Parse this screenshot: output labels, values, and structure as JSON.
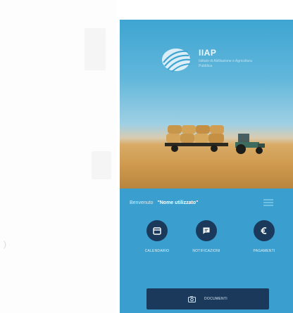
{
  "app": {
    "logo_title": "IIAP",
    "logo_subtitle": "Istituto di Abilitazione e Agricoltura Pubblica"
  },
  "main": {
    "welcome_label": "Benvenuto",
    "user_name": "\"Nome utilizzato\""
  },
  "quick_actions": [
    {
      "label": "CALENDARIO",
      "icon": "calendar-icon"
    },
    {
      "label": "NOTIFICAZIONI",
      "icon": "message-icon"
    },
    {
      "label": "PAGAMENTI",
      "icon": "euro-icon"
    }
  ],
  "bottom_button": {
    "label": "DOCUMENTI",
    "icon": "camera-icon"
  },
  "colors": {
    "primary": "#3a9fce",
    "dark_accent": "#1b3a5b",
    "text_light": "#e1f1f8"
  }
}
